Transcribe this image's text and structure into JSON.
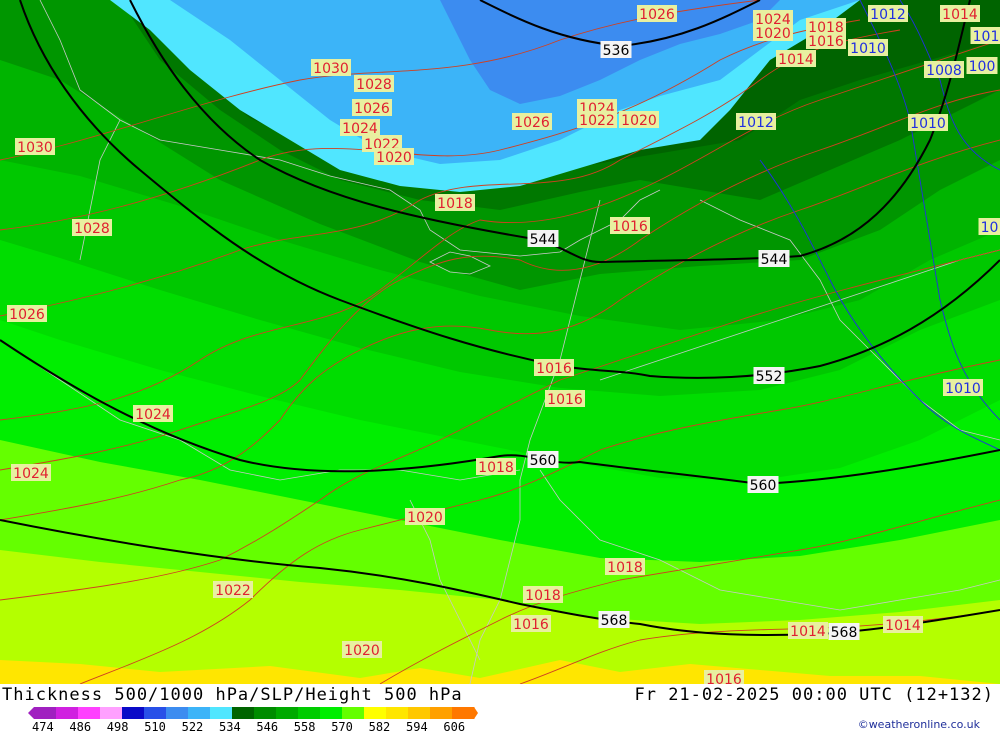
{
  "title": "Thickness 500/1000 hPa/SLP/Height 500 hPa",
  "valid_time": "Fr 21-02-2025 00:00 UTC (12+132)",
  "credit": "©weatheronline.co.uk",
  "legend": {
    "tick_labels": [
      "474",
      "486",
      "498",
      "510",
      "522",
      "534",
      "546",
      "558",
      "570",
      "582",
      "594",
      "606"
    ],
    "colors": [
      "#a020c0",
      "#d020e0",
      "#ff40ff",
      "#ffa0ff",
      "#0a0ac8",
      "#2850e8",
      "#3c8cf0",
      "#3cb4f8",
      "#50e6ff",
      "#006400",
      "#008c00",
      "#00aa00",
      "#00cc00",
      "#00ee00",
      "#64ff00",
      "#ffff00",
      "#ffe600",
      "#ffc800",
      "#ffa000",
      "#ff7800"
    ]
  },
  "slp_labels": [
    "1030",
    "1028",
    "1026",
    "1024",
    "1022",
    "1020",
    "1018",
    "1016",
    "1014",
    "1012",
    "1010",
    "1008"
  ],
  "height_labels": [
    "536",
    "544",
    "552",
    "560",
    "568"
  ],
  "map_labels": [
    {
      "text": "1026",
      "kind": "slp"
    },
    {
      "text": "1024",
      "kind": "slp"
    },
    {
      "text": "1020",
      "kind": "slp"
    },
    {
      "text": "1018",
      "kind": "slp"
    },
    {
      "text": "1016",
      "kind": "slp"
    },
    {
      "text": "1012",
      "kind": "slp_low"
    },
    {
      "text": "1014",
      "kind": "slp"
    },
    {
      "text": "101",
      "kind": "slp_low"
    },
    {
      "text": "1014",
      "kind": "slp"
    },
    {
      "text": "1010",
      "kind": "slp_low"
    },
    {
      "text": "1008",
      "kind": "slp_low"
    },
    {
      "text": "100",
      "kind": "slp_low"
    },
    {
      "text": "536",
      "kind": "height"
    },
    {
      "text": "1030",
      "kind": "slp"
    },
    {
      "text": "1028",
      "kind": "slp"
    },
    {
      "text": "1026",
      "kind": "slp"
    },
    {
      "text": "1024",
      "kind": "slp"
    },
    {
      "text": "1022",
      "kind": "slp"
    },
    {
      "text": "1020",
      "kind": "slp"
    },
    {
      "text": "1026",
      "kind": "slp"
    },
    {
      "text": "1024",
      "kind": "slp"
    },
    {
      "text": "1022",
      "kind": "slp"
    },
    {
      "text": "1020",
      "kind": "slp"
    },
    {
      "text": "1012",
      "kind": "slp_low"
    },
    {
      "text": "1010",
      "kind": "slp_low"
    },
    {
      "text": "1030",
      "kind": "slp"
    },
    {
      "text": "1018",
      "kind": "slp"
    },
    {
      "text": "1016",
      "kind": "slp"
    },
    {
      "text": "1028",
      "kind": "slp"
    },
    {
      "text": "544",
      "kind": "height"
    },
    {
      "text": "544",
      "kind": "height"
    },
    {
      "text": "101",
      "kind": "slp_low"
    },
    {
      "text": "1026",
      "kind": "slp"
    },
    {
      "text": "1016",
      "kind": "slp"
    },
    {
      "text": "552",
      "kind": "height"
    },
    {
      "text": "1016",
      "kind": "slp"
    },
    {
      "text": "1010",
      "kind": "slp_low"
    },
    {
      "text": "1024",
      "kind": "slp"
    },
    {
      "text": "1024",
      "kind": "slp"
    },
    {
      "text": "1018",
      "kind": "slp"
    },
    {
      "text": "560",
      "kind": "height"
    },
    {
      "text": "560",
      "kind": "height"
    },
    {
      "text": "1020",
      "kind": "slp"
    },
    {
      "text": "1018",
      "kind": "slp"
    },
    {
      "text": "1022",
      "kind": "slp"
    },
    {
      "text": "1018",
      "kind": "slp"
    },
    {
      "text": "1016",
      "kind": "slp"
    },
    {
      "text": "568",
      "kind": "height"
    },
    {
      "text": "1014",
      "kind": "slp"
    },
    {
      "text": "568",
      "kind": "height"
    },
    {
      "text": "1014",
      "kind": "slp"
    },
    {
      "text": "1020",
      "kind": "slp"
    },
    {
      "text": "1016",
      "kind": "slp"
    }
  ]
}
